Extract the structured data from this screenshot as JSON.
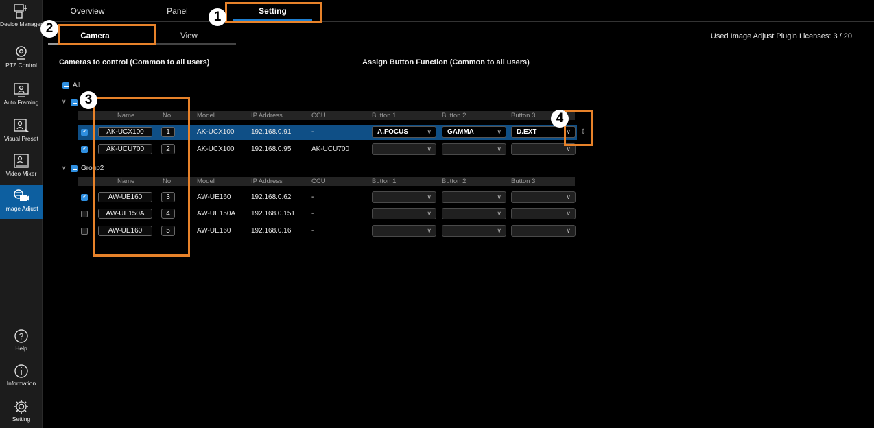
{
  "sidebar": {
    "items": [
      {
        "label": "Device Manager",
        "icon": "device-manager-icon"
      },
      {
        "label": "PTZ Control",
        "icon": "ptz-control-icon"
      },
      {
        "label": "Auto Framing",
        "icon": "auto-framing-icon"
      },
      {
        "label": "Visual Preset",
        "icon": "visual-preset-icon"
      },
      {
        "label": "Video Mixer",
        "icon": "video-mixer-icon"
      },
      {
        "label": "Image Adjust",
        "icon": "image-adjust-icon",
        "active": true
      },
      {
        "label": "Help",
        "icon": "help-icon"
      },
      {
        "label": "Information",
        "icon": "information-icon"
      },
      {
        "label": "Setting",
        "icon": "gear-icon"
      }
    ]
  },
  "top_tabs": [
    {
      "label": "Overview"
    },
    {
      "label": "Panel"
    },
    {
      "label": "Setting",
      "active": true
    }
  ],
  "sub_tabs": [
    {
      "label": "Camera",
      "active": true
    },
    {
      "label": "View"
    }
  ],
  "licenses_text": "Used Image Adjust Plugin Licenses: 3 / 20",
  "sections": {
    "cameras_title": "Cameras to control (Common to all users)",
    "assign_title": "Assign Button Function (Common to all users)"
  },
  "tree": {
    "all_label": "All",
    "group1_label": "",
    "group2_label": "Group2"
  },
  "columns": {
    "name": "Name",
    "no": "No.",
    "model": "Model",
    "ip": "IP Address",
    "ccu": "CCU",
    "button1": "Button 1",
    "button2": "Button 2",
    "button3": "Button 3"
  },
  "group1_rows": [
    {
      "checked": true,
      "name": "AK-UCX100",
      "no": "1",
      "model": "AK-UCX100",
      "ip": "192.168.0.91",
      "ccu": "-",
      "b1": "A.FOCUS",
      "b2": "GAMMA",
      "b3": "D.EXT",
      "selected": true
    },
    {
      "checked": true,
      "name": "AK-UCU700",
      "no": "2",
      "model": "AK-UCX100",
      "ip": "192.168.0.95",
      "ccu": "AK-UCU700",
      "b1": "",
      "b2": "",
      "b3": ""
    }
  ],
  "group2_rows": [
    {
      "checked": true,
      "name": "AW-UE160",
      "no": "3",
      "model": "AW-UE160",
      "ip": "192.168.0.62",
      "ccu": "-",
      "b1": "",
      "b2": "",
      "b3": ""
    },
    {
      "checked": false,
      "name": "AW-UE150A",
      "no": "4",
      "model": "AW-UE150A",
      "ip": "192.168.0.151",
      "ccu": "-",
      "b1": "",
      "b2": "",
      "b3": ""
    },
    {
      "checked": false,
      "name": "AW-UE160",
      "no": "5",
      "model": "AW-UE160",
      "ip": "192.168.0.16",
      "ccu": "-",
      "b1": "",
      "b2": "",
      "b3": ""
    }
  ],
  "annotations": [
    "1",
    "2",
    "3",
    "4"
  ],
  "colors": {
    "accent": "#1e7fd1",
    "selected_row": "#0f4f86",
    "annotation": "#e7822a",
    "sidebar_active": "#0d5fa0"
  }
}
